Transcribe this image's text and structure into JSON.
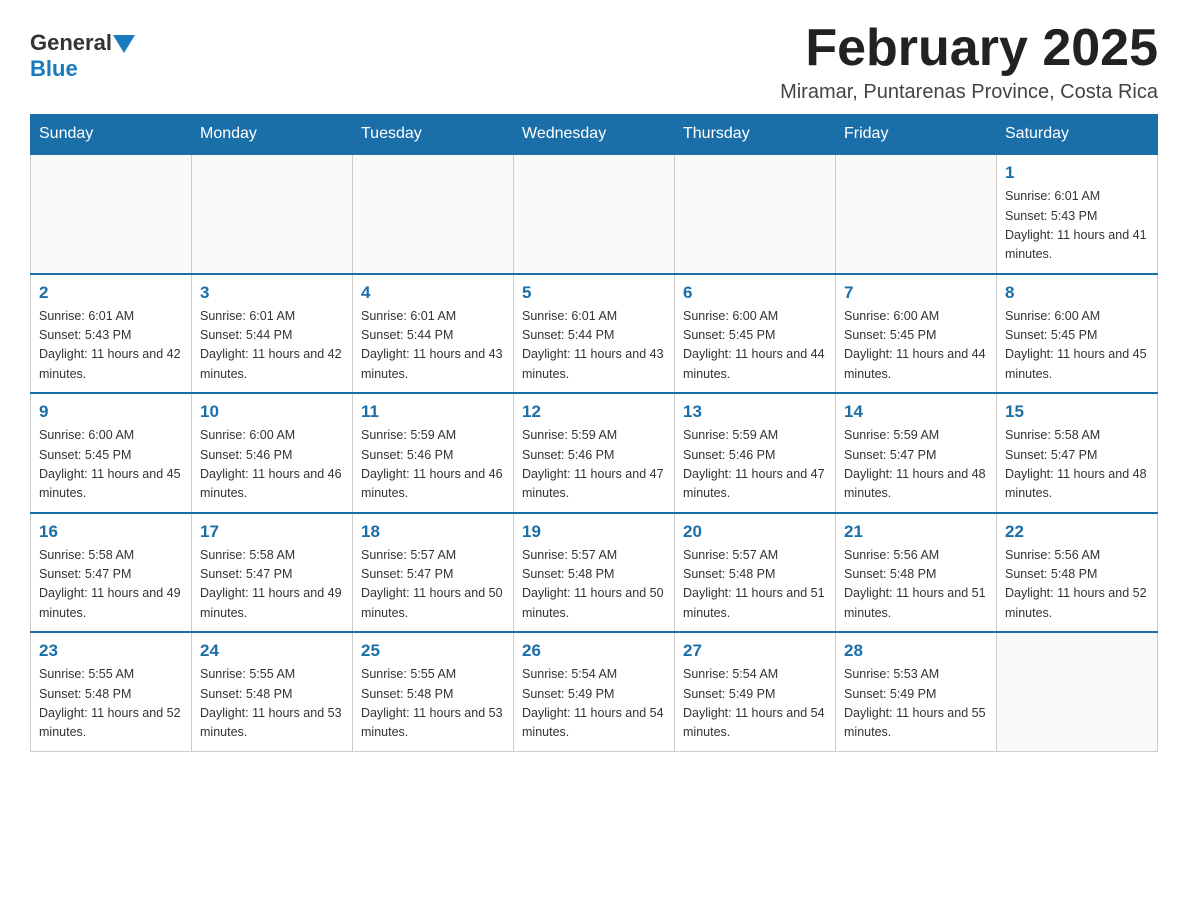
{
  "header": {
    "logo_general": "General",
    "logo_blue": "Blue",
    "month_title": "February 2025",
    "location": "Miramar, Puntarenas Province, Costa Rica"
  },
  "days_of_week": [
    "Sunday",
    "Monday",
    "Tuesday",
    "Wednesday",
    "Thursday",
    "Friday",
    "Saturday"
  ],
  "weeks": [
    [
      {
        "day": "",
        "info": ""
      },
      {
        "day": "",
        "info": ""
      },
      {
        "day": "",
        "info": ""
      },
      {
        "day": "",
        "info": ""
      },
      {
        "day": "",
        "info": ""
      },
      {
        "day": "",
        "info": ""
      },
      {
        "day": "1",
        "info": "Sunrise: 6:01 AM\nSunset: 5:43 PM\nDaylight: 11 hours and 41 minutes."
      }
    ],
    [
      {
        "day": "2",
        "info": "Sunrise: 6:01 AM\nSunset: 5:43 PM\nDaylight: 11 hours and 42 minutes."
      },
      {
        "day": "3",
        "info": "Sunrise: 6:01 AM\nSunset: 5:44 PM\nDaylight: 11 hours and 42 minutes."
      },
      {
        "day": "4",
        "info": "Sunrise: 6:01 AM\nSunset: 5:44 PM\nDaylight: 11 hours and 43 minutes."
      },
      {
        "day": "5",
        "info": "Sunrise: 6:01 AM\nSunset: 5:44 PM\nDaylight: 11 hours and 43 minutes."
      },
      {
        "day": "6",
        "info": "Sunrise: 6:00 AM\nSunset: 5:45 PM\nDaylight: 11 hours and 44 minutes."
      },
      {
        "day": "7",
        "info": "Sunrise: 6:00 AM\nSunset: 5:45 PM\nDaylight: 11 hours and 44 minutes."
      },
      {
        "day": "8",
        "info": "Sunrise: 6:00 AM\nSunset: 5:45 PM\nDaylight: 11 hours and 45 minutes."
      }
    ],
    [
      {
        "day": "9",
        "info": "Sunrise: 6:00 AM\nSunset: 5:45 PM\nDaylight: 11 hours and 45 minutes."
      },
      {
        "day": "10",
        "info": "Sunrise: 6:00 AM\nSunset: 5:46 PM\nDaylight: 11 hours and 46 minutes."
      },
      {
        "day": "11",
        "info": "Sunrise: 5:59 AM\nSunset: 5:46 PM\nDaylight: 11 hours and 46 minutes."
      },
      {
        "day": "12",
        "info": "Sunrise: 5:59 AM\nSunset: 5:46 PM\nDaylight: 11 hours and 47 minutes."
      },
      {
        "day": "13",
        "info": "Sunrise: 5:59 AM\nSunset: 5:46 PM\nDaylight: 11 hours and 47 minutes."
      },
      {
        "day": "14",
        "info": "Sunrise: 5:59 AM\nSunset: 5:47 PM\nDaylight: 11 hours and 48 minutes."
      },
      {
        "day": "15",
        "info": "Sunrise: 5:58 AM\nSunset: 5:47 PM\nDaylight: 11 hours and 48 minutes."
      }
    ],
    [
      {
        "day": "16",
        "info": "Sunrise: 5:58 AM\nSunset: 5:47 PM\nDaylight: 11 hours and 49 minutes."
      },
      {
        "day": "17",
        "info": "Sunrise: 5:58 AM\nSunset: 5:47 PM\nDaylight: 11 hours and 49 minutes."
      },
      {
        "day": "18",
        "info": "Sunrise: 5:57 AM\nSunset: 5:47 PM\nDaylight: 11 hours and 50 minutes."
      },
      {
        "day": "19",
        "info": "Sunrise: 5:57 AM\nSunset: 5:48 PM\nDaylight: 11 hours and 50 minutes."
      },
      {
        "day": "20",
        "info": "Sunrise: 5:57 AM\nSunset: 5:48 PM\nDaylight: 11 hours and 51 minutes."
      },
      {
        "day": "21",
        "info": "Sunrise: 5:56 AM\nSunset: 5:48 PM\nDaylight: 11 hours and 51 minutes."
      },
      {
        "day": "22",
        "info": "Sunrise: 5:56 AM\nSunset: 5:48 PM\nDaylight: 11 hours and 52 minutes."
      }
    ],
    [
      {
        "day": "23",
        "info": "Sunrise: 5:55 AM\nSunset: 5:48 PM\nDaylight: 11 hours and 52 minutes."
      },
      {
        "day": "24",
        "info": "Sunrise: 5:55 AM\nSunset: 5:48 PM\nDaylight: 11 hours and 53 minutes."
      },
      {
        "day": "25",
        "info": "Sunrise: 5:55 AM\nSunset: 5:48 PM\nDaylight: 11 hours and 53 minutes."
      },
      {
        "day": "26",
        "info": "Sunrise: 5:54 AM\nSunset: 5:49 PM\nDaylight: 11 hours and 54 minutes."
      },
      {
        "day": "27",
        "info": "Sunrise: 5:54 AM\nSunset: 5:49 PM\nDaylight: 11 hours and 54 minutes."
      },
      {
        "day": "28",
        "info": "Sunrise: 5:53 AM\nSunset: 5:49 PM\nDaylight: 11 hours and 55 minutes."
      },
      {
        "day": "",
        "info": ""
      }
    ]
  ]
}
